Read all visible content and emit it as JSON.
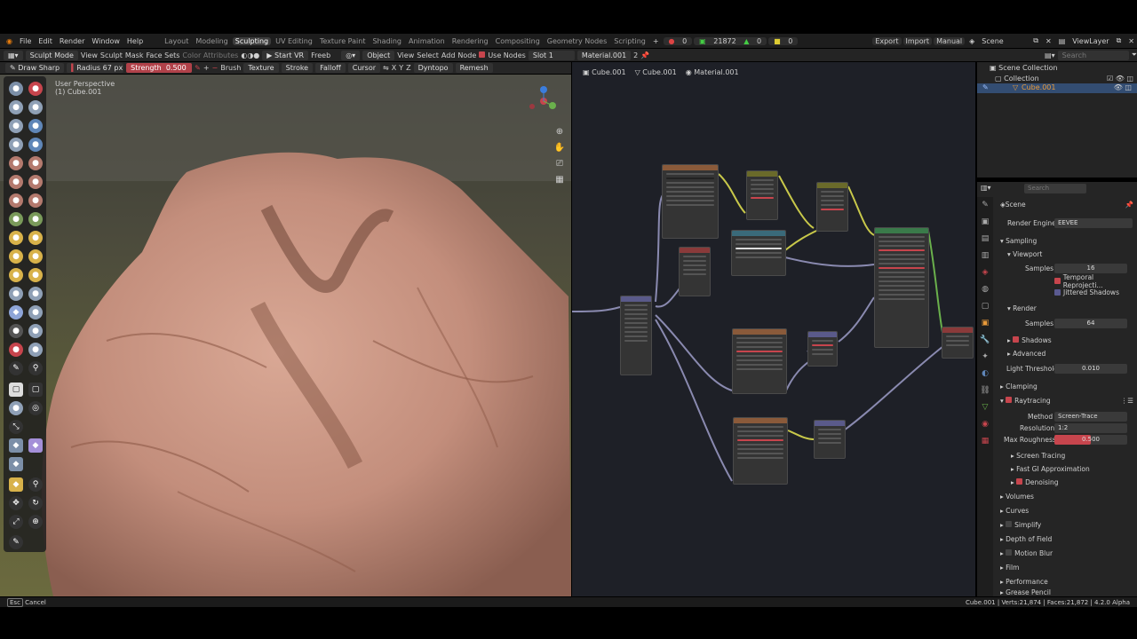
{
  "topbar": {
    "menus": [
      "File",
      "Edit",
      "Render",
      "Window",
      "Help"
    ],
    "workspaces": [
      "Layout",
      "Modeling",
      "Sculpting",
      "UV Editing",
      "Texture Paint",
      "Shading",
      "Animation",
      "Rendering",
      "Compositing",
      "Geometry Nodes",
      "Scripting"
    ],
    "active_workspace": "Sculpting",
    "stat_a": "0",
    "stat_b": "21872",
    "stat_c": "0",
    "stat_d": "0",
    "export": "Export",
    "import": "Import",
    "manual": "Manual",
    "scene": "Scene",
    "viewlayer": "ViewLayer"
  },
  "row2": {
    "mode": "Sculpt Mode",
    "view": "View",
    "sculpt": "Sculpt",
    "mask": "Mask",
    "face_sets": "Face Sets",
    "color_attributes": "Color Attributes",
    "start_vr": "Start VR",
    "freeb": "Freeb",
    "object": "Object",
    "view2": "View",
    "select": "Select",
    "add": "Add",
    "node": "Node",
    "use_nodes": "Use Nodes",
    "slot": "Slot 1",
    "material": "Material.001",
    "material_users": "2",
    "search_placeholder": "Search"
  },
  "row3": {
    "brush_name": "Draw Sharp",
    "radius_label": "Radius",
    "radius_value": "67 px",
    "strength_label": "Strength",
    "strength_value": "0.500",
    "brush": "Brush",
    "texture": "Texture",
    "stroke": "Stroke",
    "falloff": "Falloff",
    "cursor": "Cursor",
    "axis_x": "X",
    "axis_y": "Y",
    "axis_z": "Z",
    "dyntopo": "Dyntopo",
    "remesh": "Remesh"
  },
  "viewport": {
    "perspective": "User Perspective",
    "object": "(1) Cube.001"
  },
  "node_editor": {
    "breadcrumbs": [
      "Cube.001",
      "Cube.001",
      "Material.001"
    ]
  },
  "outliner": {
    "scene_collection": "Scene Collection",
    "collection": "Collection",
    "object": "Cube.001"
  },
  "properties": {
    "search_placeholder": "Search",
    "scene": "Scene",
    "render_engine_label": "Render Engine",
    "render_engine": "EEVEE",
    "sampling": "Sampling",
    "viewport": "Viewport",
    "samples_label": "Samples",
    "viewport_samples": "16",
    "temporal": "Temporal Reprojecti...",
    "jittered": "Jittered Shadows",
    "render": "Render",
    "render_samples": "64",
    "shadows": "Shadows",
    "advanced": "Advanced",
    "light_threshold_label": "Light Threshold",
    "light_threshold": "0.010",
    "clamping": "Clamping",
    "raytracing": "Raytracing",
    "method_label": "Method",
    "method": "Screen-Trace",
    "resolution_label": "Resolution",
    "resolution": "1:2",
    "max_roughness_label": "Max Roughness",
    "max_roughness": "0.500",
    "max_roughness_fraction": 0.5,
    "screen_tracing": "Screen Tracing",
    "fast_gi": "Fast GI Approximation",
    "denoising": "Denoising",
    "volumes": "Volumes",
    "curves": "Curves",
    "simplify": "Simplify",
    "dof": "Depth of Field",
    "motion_blur": "Motion Blur",
    "film": "Film",
    "performance": "Performance",
    "grease_pencil": "Grease Pencil"
  },
  "statusbar": {
    "cancel": "Cancel",
    "stats": "Cube.001 | Verts:21,874 | Faces:21,872 | 4.2.0 Alpha"
  },
  "colors": {
    "accent_red": "#c7454d",
    "selected_blue": "#2f4c72",
    "node_bg": "#1e2027"
  }
}
